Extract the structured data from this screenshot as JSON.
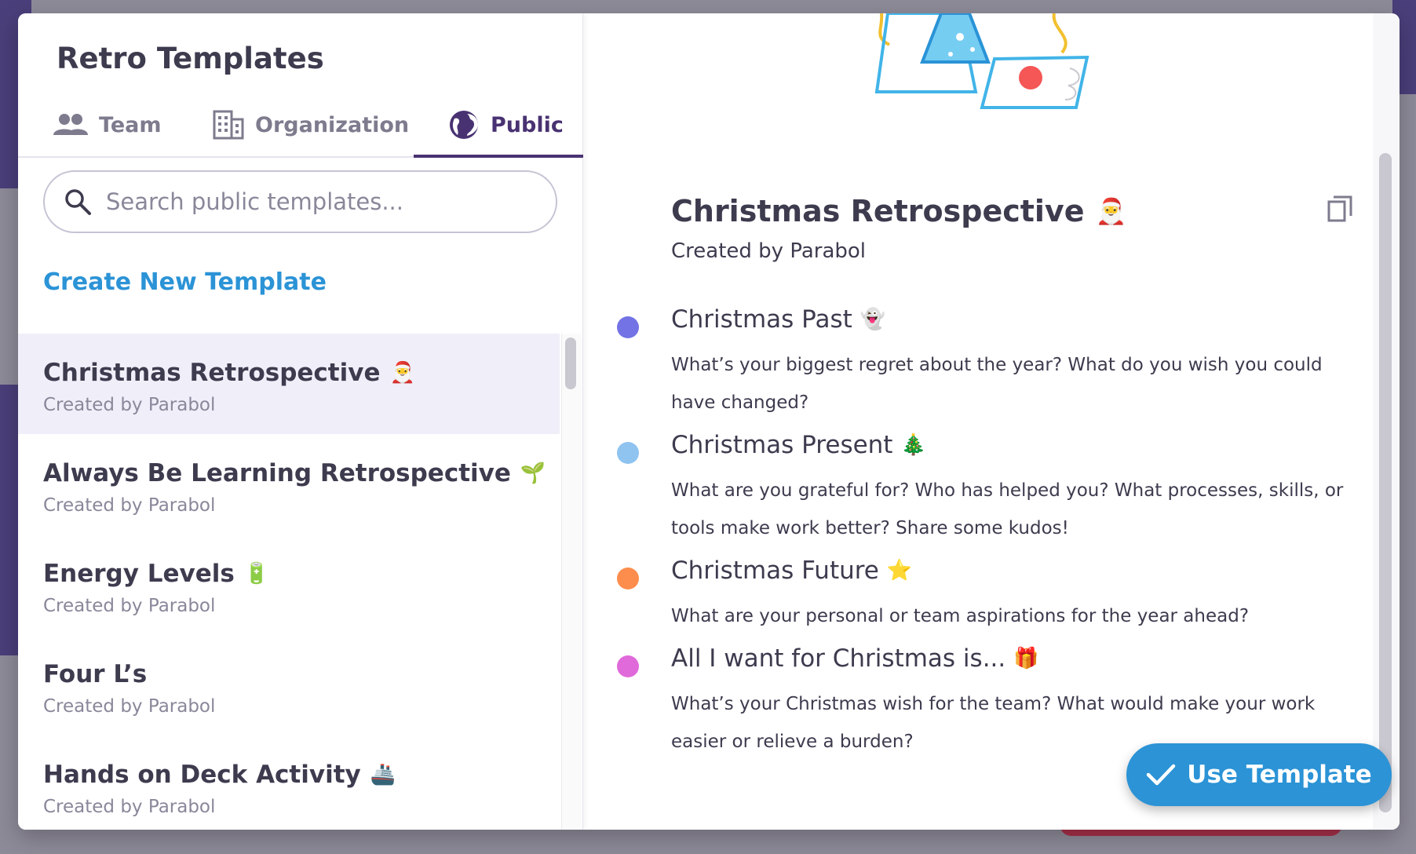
{
  "header": {
    "title": "Retro Templates"
  },
  "tabs": [
    {
      "label": "Team",
      "icon": "team-icon"
    },
    {
      "label": "Organization",
      "icon": "building-icon"
    },
    {
      "label": "Public",
      "icon": "globe-icon",
      "active": true
    }
  ],
  "search": {
    "placeholder": "Search public templates..."
  },
  "create_link": "Create New Template",
  "templates": [
    {
      "name": "Christmas Retrospective",
      "emoji": "🎅",
      "creator": "Created by Parabol",
      "selected": true
    },
    {
      "name": "Always Be Learning Retrospective",
      "emoji": "🌱",
      "creator": "Created by Parabol"
    },
    {
      "name": "Energy Levels",
      "emoji": "🔋",
      "creator": "Created by Parabol"
    },
    {
      "name": "Four L’s",
      "emoji": "",
      "creator": "Created by Parabol"
    },
    {
      "name": "Hands on Deck Activity",
      "emoji": "🚢",
      "creator": "Created by Parabol"
    }
  ],
  "detail": {
    "title": "Christmas Retrospective",
    "emoji": "🎅",
    "creator": "Created by Parabol",
    "prompts": [
      {
        "title": "Christmas Past",
        "emoji": "👻",
        "color": "#7373e5",
        "description": "What’s your biggest regret about the year? What do you wish you could have changed?"
      },
      {
        "title": "Christmas Present",
        "emoji": "🎄",
        "color": "#8fc3f0",
        "description": "What are you grateful for? Who has helped you? What processes, skills, or tools make work better? Share some kudos!"
      },
      {
        "title": "Christmas Future",
        "emoji": "⭐",
        "color": "#fd8d4c",
        "description": "What are your personal or team aspirations for the year ahead?"
      },
      {
        "title": "All I want for Christmas is...",
        "emoji": "🎁",
        "color": "#e06ad9",
        "description": "What’s your Christmas wish for the team? What would make your work easier or relieve a burden?"
      }
    ]
  },
  "use_button": "Use Template",
  "colors": {
    "accent": "#2b93d6",
    "brand": "#493272",
    "selected_bg": "#f0eff9"
  }
}
